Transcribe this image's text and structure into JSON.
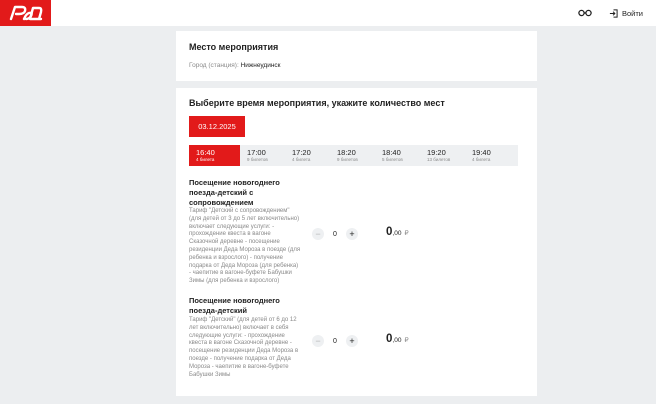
{
  "header": {
    "logo_icon": "rzd-logo",
    "accessibility_icon": "glasses-icon",
    "login_icon": "login-icon",
    "login_label": "Войти"
  },
  "venue": {
    "title": "Место мероприятия",
    "city_label": "Город (станция):",
    "city_value": "Нижнеудинск"
  },
  "schedule": {
    "title": "Выберите время мероприятия, укажите количество мест",
    "date": "03.12.2025",
    "slots": [
      {
        "time": "16:40",
        "tickets": "4 билета",
        "active": true
      },
      {
        "time": "17:00",
        "tickets": "9 билетов",
        "active": false
      },
      {
        "time": "17:20",
        "tickets": "4 билета",
        "active": false
      },
      {
        "time": "18:20",
        "tickets": "9 билетов",
        "active": false
      },
      {
        "time": "18:40",
        "tickets": "5 билетов",
        "active": false
      },
      {
        "time": "19:20",
        "tickets": "13 билетов",
        "active": false
      },
      {
        "time": "19:40",
        "tickets": "4 билета",
        "active": false
      }
    ]
  },
  "tickets": [
    {
      "name": "Посещение новогоднего поезда-детский с сопровождением",
      "description": "Тариф \"Детский с сопровождением\" (для детей от 3 до 5 лет включительно) включает следующие услуги: - прохождение квеста в вагоне Сказочной деревне - посещение резиденции Деда Мороза в поезде (для ребенка и взрослого) - получение подарка от Деда Мороза (для ребенка) - чаепитие в вагоне-буфете Бабушки Зимы (для ребенка и взрослого)",
      "quantity": "0",
      "price_int": "0",
      "price_dec": ",00",
      "currency": "₽"
    },
    {
      "name": "Посещение новогоднего поезда-детский",
      "description": "Тариф \"Детский\" (для детей от 6 до 12 лет включительно) включает в себя следующие услуги: - прохождение квеста в вагоне Сказочной деревне - посещение резиденции Деда Мороза в поезде - получение подарка от Деда Мороза - чаепитие в вагоне-буфете Бабушки Зимы",
      "quantity": "0",
      "price_int": "0",
      "price_dec": ",00",
      "currency": "₽"
    }
  ],
  "stepper": {
    "minus": "−",
    "plus": "+"
  },
  "colors": {
    "brand": "#e21a1a",
    "background": "#eceef0",
    "slot_bg": "#eef0f2"
  }
}
